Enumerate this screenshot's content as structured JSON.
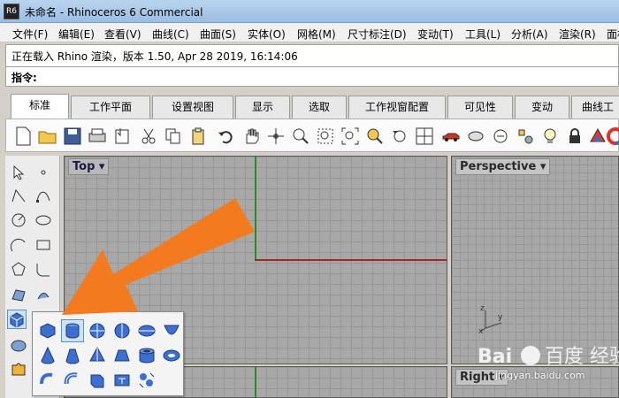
{
  "window": {
    "title": "未命名 - Rhinoceros 6 Commercial",
    "icon_label": "R6"
  },
  "menu": [
    "文件(F)",
    "编辑(E)",
    "查看(V)",
    "曲线(C)",
    "曲面(S)",
    "实体(O)",
    "网格(M)",
    "尺寸标注(D)",
    "变动(T)",
    "工具(L)",
    "分析(A)",
    "渲染(R)",
    "面板"
  ],
  "command": {
    "history": "正在载入 Rhino 渲染，版本 1.50, Apr 28 2019, 16:14:06",
    "prompt": "指令:"
  },
  "tabs": [
    "标准",
    "工作平面",
    "设置视图",
    "显示",
    "选取",
    "工作视窗配置",
    "可见性",
    "变动",
    "曲线工"
  ],
  "active_tab": "标准",
  "viewports": {
    "top": "Top",
    "perspective": "Perspective",
    "right": "Right"
  },
  "colors": {
    "accent_arrow": "#f47a20",
    "x_axis": "#9a2a2a",
    "y_axis": "#2a8a2a"
  },
  "watermark": {
    "logo": "Bai百度 经验",
    "url": "jingyan.baidu.com"
  }
}
